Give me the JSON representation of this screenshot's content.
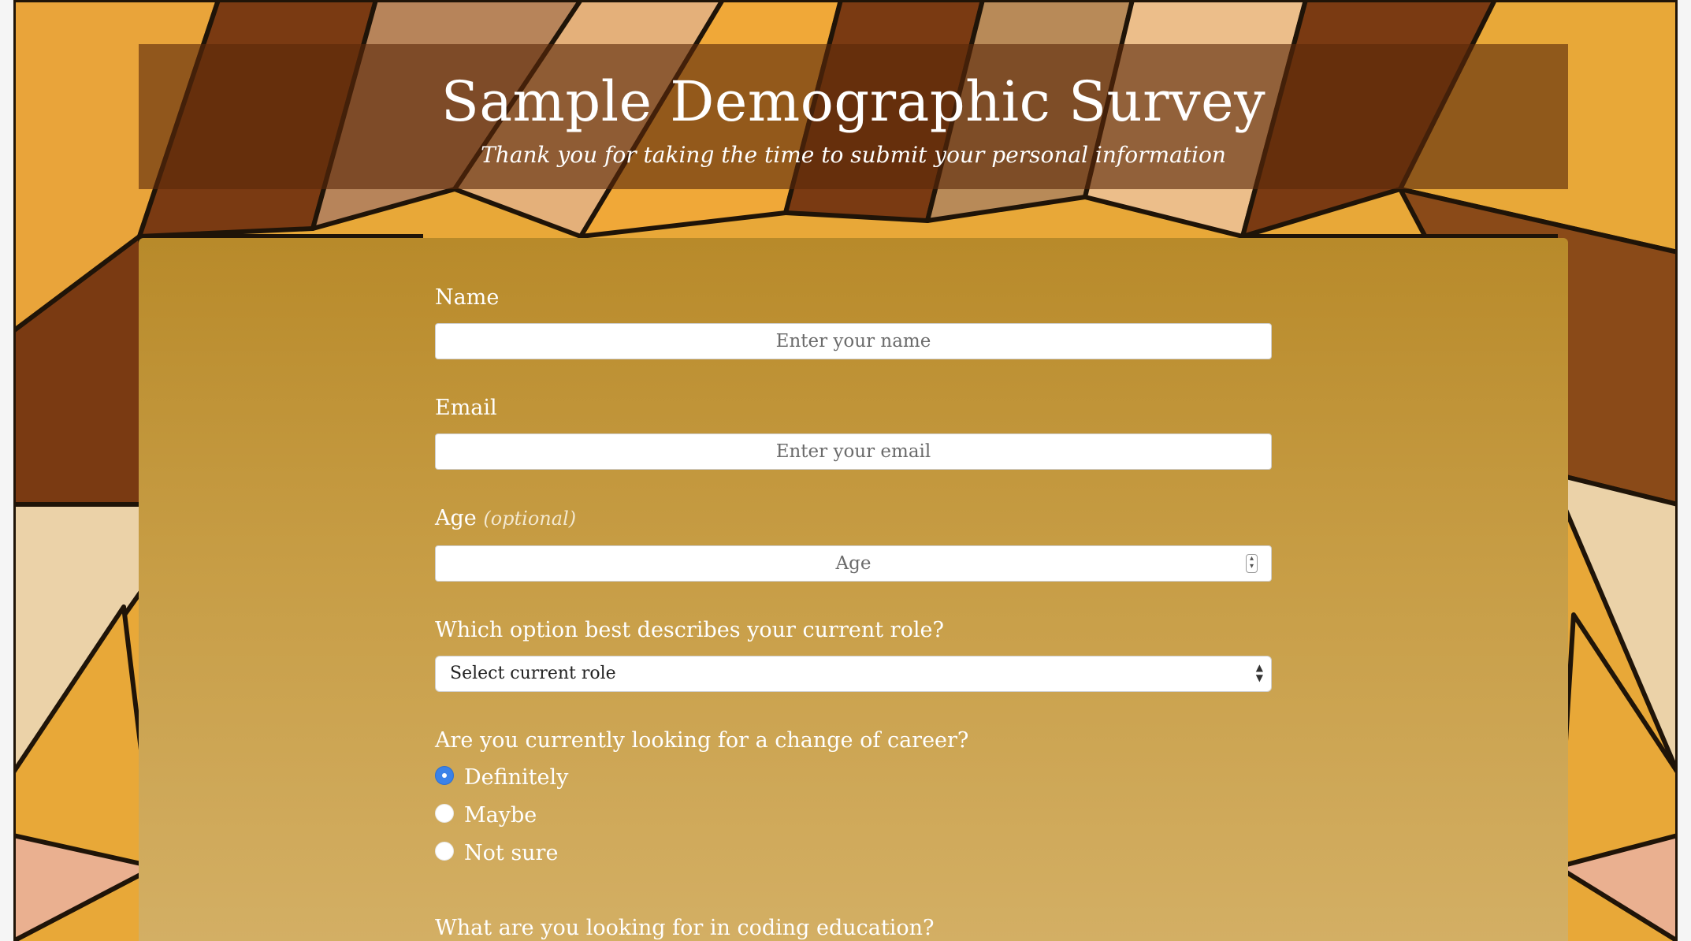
{
  "header": {
    "title": "Sample Demographic Survey",
    "subtitle": "Thank you for taking the time to submit your personal information"
  },
  "form": {
    "name": {
      "label": "Name",
      "placeholder": "Enter your name",
      "value": ""
    },
    "email": {
      "label": "Email",
      "placeholder": "Enter your email",
      "value": ""
    },
    "age": {
      "label": "Age",
      "optional_note": "(optional)",
      "placeholder": "Age",
      "value": ""
    },
    "role": {
      "label": "Which option best describes your current role?",
      "selected": "Select current role"
    },
    "career_change": {
      "label": "Are you currently looking for a change of career?",
      "options": [
        {
          "label": "Definitely",
          "checked": true
        },
        {
          "label": "Maybe",
          "checked": false
        },
        {
          "label": "Not sure",
          "checked": false
        }
      ]
    },
    "coding_education": {
      "label": "What are you looking for in coding education?"
    }
  },
  "colors": {
    "header_overlay": "#5a280a",
    "panel_top": "#b88a2a",
    "panel_bottom": "#d4b066",
    "radio_accent": "#3b82e8"
  }
}
